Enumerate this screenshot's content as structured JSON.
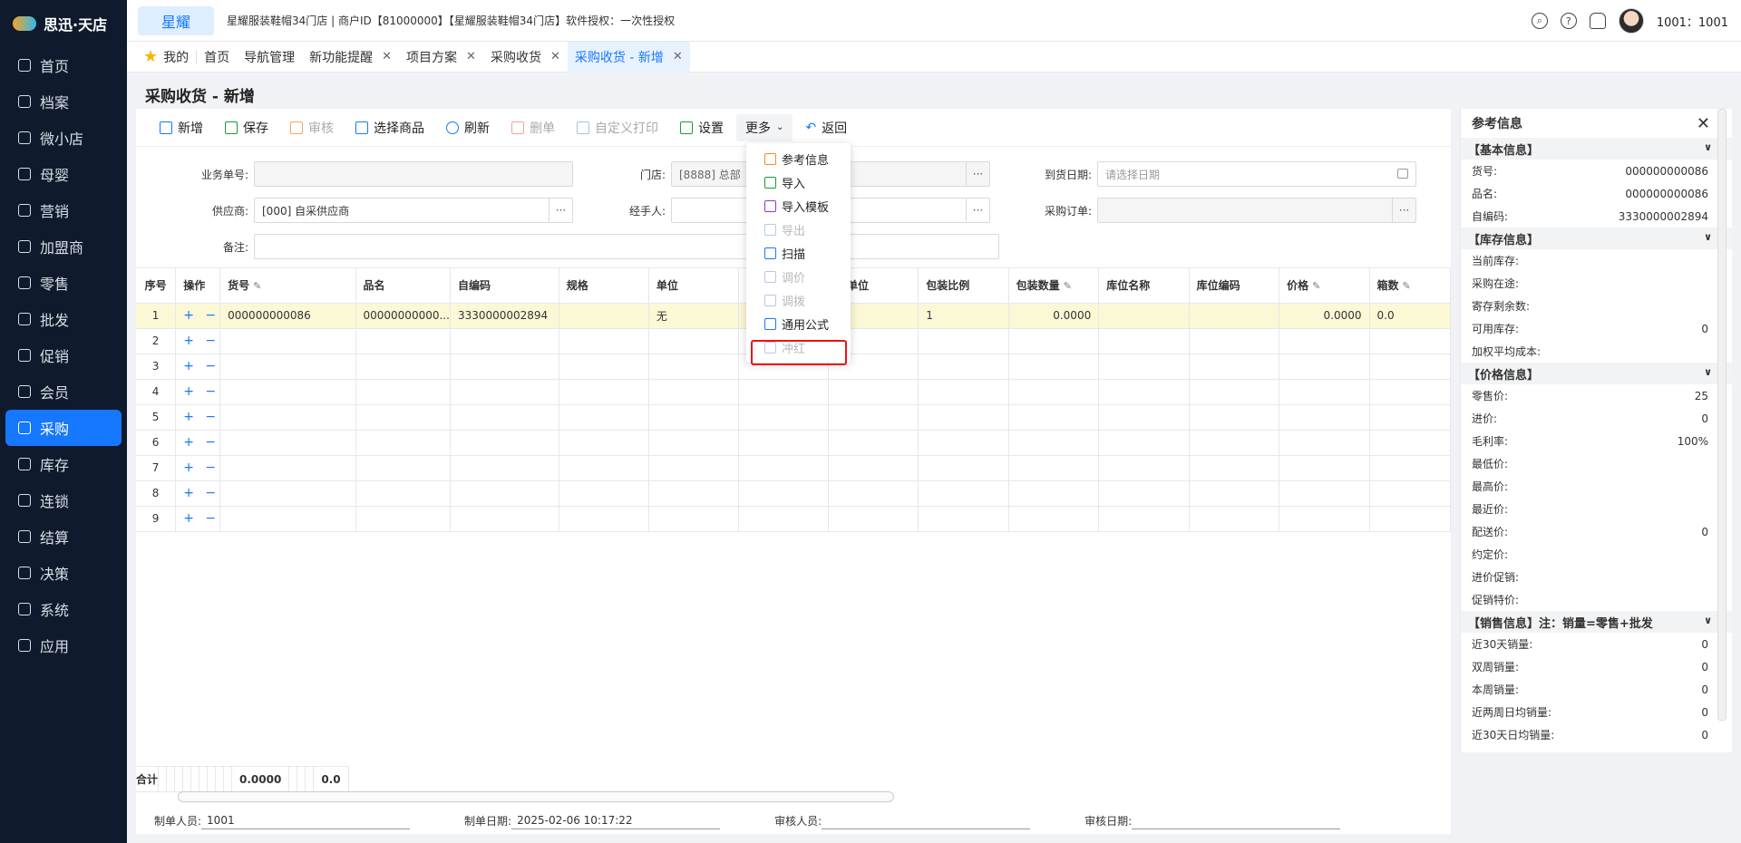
{
  "sidebar": {
    "logo": "思迅·天店",
    "items": [
      {
        "label": "首页",
        "icon": "home-icon"
      },
      {
        "label": "档案",
        "icon": "folder-icon"
      },
      {
        "label": "微小店",
        "icon": "shop-icon"
      },
      {
        "label": "母婴",
        "icon": "baby-icon"
      },
      {
        "label": "营销",
        "icon": "marketing-icon"
      },
      {
        "label": "加盟商",
        "icon": "franchise-icon"
      },
      {
        "label": "零售",
        "icon": "retail-icon"
      },
      {
        "label": "批发",
        "icon": "wholesale-icon"
      },
      {
        "label": "促销",
        "icon": "promotion-icon"
      },
      {
        "label": "会员",
        "icon": "member-icon"
      },
      {
        "label": "采购",
        "icon": "cart-icon"
      },
      {
        "label": "库存",
        "icon": "inventory-icon"
      },
      {
        "label": "连锁",
        "icon": "chain-icon"
      },
      {
        "label": "结算",
        "icon": "settle-icon"
      },
      {
        "label": "决策",
        "icon": "decision-icon"
      },
      {
        "label": "系统",
        "icon": "system-icon"
      },
      {
        "label": "应用",
        "icon": "app-icon"
      }
    ],
    "active_index": 10
  },
  "header": {
    "brand_button": "星耀",
    "store_info": "星耀服装鞋帽34门店 | 商户ID【81000000】【星耀服装鞋帽34门店】软件授权：一次性授权",
    "user": "1001：1001"
  },
  "tabs": [
    {
      "label": "我的",
      "closable": false
    },
    {
      "label": "首页",
      "closable": false
    },
    {
      "label": "导航管理",
      "closable": false
    },
    {
      "label": "新功能提醒",
      "closable": true
    },
    {
      "label": "项目方案",
      "closable": true
    },
    {
      "label": "采购收货",
      "closable": true
    },
    {
      "label": "采购收货 - 新增",
      "closable": true,
      "active": true
    }
  ],
  "page_title": "采购收货 - 新增",
  "toolbar": {
    "new": "新增",
    "save": "保存",
    "audit": "审核",
    "select_goods": "选择商品",
    "refresh": "刷新",
    "delete": "删单",
    "custom_print": "自定义打印",
    "settings": "设置",
    "more": "更多",
    "back": "返回"
  },
  "form": {
    "order_no_label": "业务单号:",
    "order_no_value": "",
    "store_label": "门店:",
    "store_value": "[8888] 总部",
    "arrival_label": "到货日期:",
    "arrival_placeholder": "请选择日期",
    "supplier_label": "供应商:",
    "supplier_value": "[000] 自采供应商",
    "handler_label": "经手人:",
    "handler_value": "",
    "po_label": "采购订单:",
    "po_value": "",
    "remark_label": "备注:",
    "remark_value": ""
  },
  "more_menu": {
    "items": [
      {
        "label": "参考信息",
        "disabled": false,
        "color": "orange"
      },
      {
        "label": "导入",
        "disabled": false,
        "color": "green"
      },
      {
        "label": "导入模板",
        "disabled": false,
        "color": "purple"
      },
      {
        "label": "导出",
        "disabled": true,
        "color": "grey"
      },
      {
        "label": "扫描",
        "disabled": false,
        "color": "blue"
      },
      {
        "label": "调价",
        "disabled": true,
        "color": "grey"
      },
      {
        "label": "调拨",
        "disabled": true,
        "color": "grey"
      },
      {
        "label": "通用公式",
        "disabled": false,
        "color": "blue"
      },
      {
        "label": "冲红",
        "disabled": true,
        "color": "grey",
        "highlighted": true
      }
    ]
  },
  "grid": {
    "columns": [
      "序号",
      "操作",
      "货号",
      "品名",
      "自编码",
      "规格",
      "单位",
      "",
      "装单位",
      "包装比例",
      "包装数量",
      "库位名称",
      "库位编码",
      "价格",
      "箱数"
    ],
    "op_label": "+ −",
    "rows": [
      {
        "seq": "1",
        "sku": "000000000086",
        "name": "00000000000...",
        "code": "3330000002894",
        "spec": "",
        "unit": "无",
        "c7": "无",
        "pkg_unit": "",
        "ratio": "1",
        "pkg_qty": "0.0000",
        "loc_name": "",
        "loc_code": "",
        "price": "0.0000",
        "boxes": "0.0"
      },
      {
        "seq": "2"
      },
      {
        "seq": "3"
      },
      {
        "seq": "4"
      },
      {
        "seq": "5"
      },
      {
        "seq": "6"
      },
      {
        "seq": "7"
      },
      {
        "seq": "8"
      },
      {
        "seq": "9"
      }
    ],
    "sum_label": "合计",
    "sum_pkg_qty": "0.0000",
    "sum_boxes": "0.0"
  },
  "footer": {
    "maker_label": "制单人员:",
    "maker_value": "1001",
    "make_date_label": "制单日期:",
    "make_date_value": "2025-02-06 10:17:22",
    "auditor_label": "审核人员:",
    "auditor_value": "",
    "audit_date_label": "审核日期:",
    "audit_date_value": ""
  },
  "ref_panel": {
    "title": "参考信息",
    "sections": [
      {
        "title": "【基本信息】",
        "rows": [
          {
            "k": "货号:",
            "v": "000000000086"
          },
          {
            "k": "品名:",
            "v": "000000000086"
          },
          {
            "k": "自编码:",
            "v": "3330000002894"
          }
        ]
      },
      {
        "title": "【库存信息】",
        "rows": [
          {
            "k": "当前库存:",
            "v": ""
          },
          {
            "k": "采购在途:",
            "v": ""
          },
          {
            "k": "寄存剩余数:",
            "v": ""
          },
          {
            "k": "可用库存:",
            "v": "0"
          },
          {
            "k": "加权平均成本:",
            "v": ""
          }
        ]
      },
      {
        "title": "【价格信息】",
        "rows": [
          {
            "k": "零售价:",
            "v": "25"
          },
          {
            "k": "进价:",
            "v": "0"
          },
          {
            "k": "毛利率:",
            "v": "100%"
          },
          {
            "k": "最低价:",
            "v": ""
          },
          {
            "k": "最高价:",
            "v": ""
          },
          {
            "k": "最近价:",
            "v": ""
          },
          {
            "k": "配送价:",
            "v": "0"
          },
          {
            "k": "约定价:",
            "v": ""
          },
          {
            "k": "进价促销:",
            "v": ""
          },
          {
            "k": "促销特价:",
            "v": ""
          }
        ]
      },
      {
        "title": "【销售信息】注：销量=零售+批发",
        "rows": [
          {
            "k": "近30天销量:",
            "v": "0"
          },
          {
            "k": "双周销量:",
            "v": "0"
          },
          {
            "k": "本周销量:",
            "v": "0"
          },
          {
            "k": "近两周日均销量:",
            "v": "0"
          },
          {
            "k": "近30天日均销量:",
            "v": "0"
          }
        ]
      }
    ]
  }
}
